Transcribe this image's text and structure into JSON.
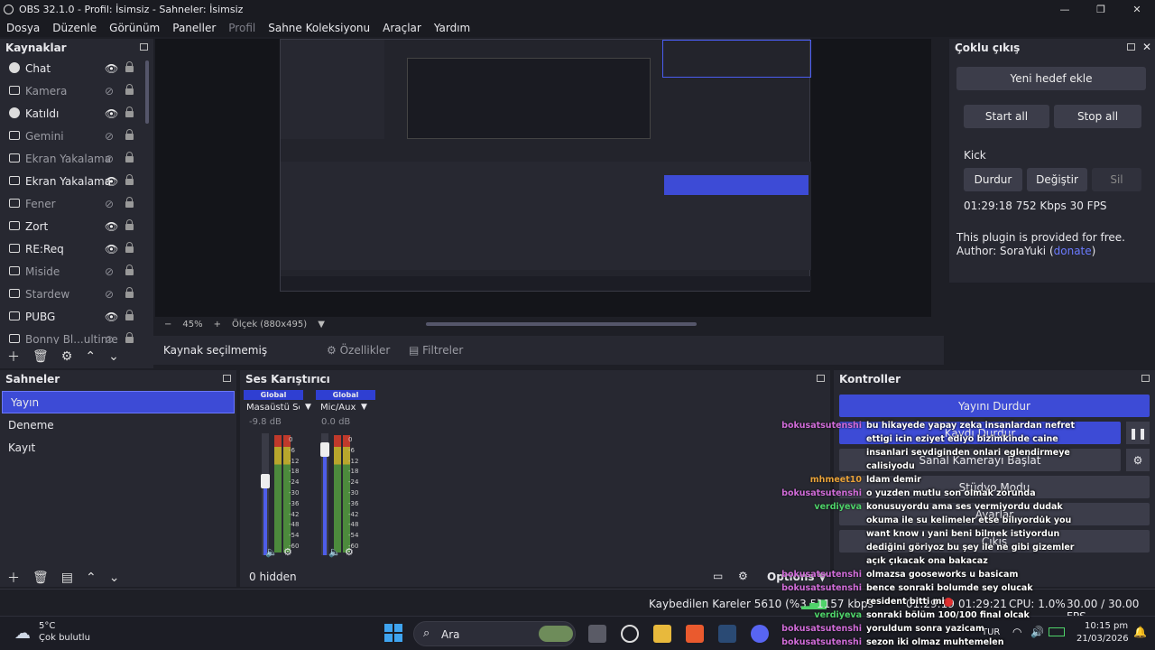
{
  "window": {
    "title": "OBS 32.1.0 - Profil: İsimsiz - Sahneler: İsimsiz"
  },
  "menu": [
    "Dosya",
    "Düzenle",
    "Görünüm",
    "Paneller",
    "Profil",
    "Sahne Koleksiyonu",
    "Araçlar",
    "Yardım"
  ],
  "sources": {
    "title": "Kaynaklar",
    "items": [
      {
        "label": "Chat",
        "visible": true,
        "icon": "globe-icon"
      },
      {
        "label": "Kamera",
        "visible": false,
        "icon": "camera-icon"
      },
      {
        "label": "Katıldı",
        "visible": true,
        "icon": "globe-icon"
      },
      {
        "label": "Gemini",
        "visible": false,
        "icon": "window-icon"
      },
      {
        "label": "Ekran Yakalama",
        "visible": false,
        "icon": "monitor-icon"
      },
      {
        "label": "Ekran Yakalama",
        "visible": true,
        "icon": "monitor-icon"
      },
      {
        "label": "Fener",
        "visible": false,
        "icon": "window-icon"
      },
      {
        "label": "Zort",
        "visible": true,
        "icon": "window-icon"
      },
      {
        "label": "RE:Req",
        "visible": true,
        "icon": "window-icon"
      },
      {
        "label": "Miside",
        "visible": false,
        "icon": "window-icon"
      },
      {
        "label": "Stardew",
        "visible": false,
        "icon": "window-icon"
      },
      {
        "label": "PUBG",
        "visible": true,
        "icon": "window-icon"
      },
      {
        "label": "Bonny Bl...ultime",
        "visible": false,
        "icon": "window-icon"
      }
    ]
  },
  "preview": {
    "zoom": "45%",
    "size_label": "Ölçek (880x495)",
    "no_source": "Kaynak seçilmemiş",
    "properties": "Özellikler",
    "filters": "Filtreler"
  },
  "multi": {
    "title": "Çoklu çıkış",
    "add": "Yeni hedef ekle",
    "start_all": "Start all",
    "stop_all": "Stop all",
    "target": "Kick",
    "stop": "Durdur",
    "edit": "Değiştir",
    "delete": "Sil",
    "stats": "01:29:18  752 Kbps  30 FPS",
    "note1": "This plugin is provided for free.",
    "note2": "Author: SoraYuki (",
    "donate": "donate",
    ")": ")"
  },
  "scenes": {
    "title": "Sahneler",
    "items": [
      "Yayın",
      "Deneme",
      "Kayıt"
    ],
    "selected": 0
  },
  "mixer": {
    "title": "Ses Karıştırıcı",
    "hidden": "0 hidden",
    "channels": [
      {
        "global": "Global",
        "name": "Masaüstü Ses",
        "db": "-9.8 dB",
        "level": 0.62
      },
      {
        "global": "Global",
        "name": "Mic/Aux",
        "db": "0.0 dB",
        "level": 0.92
      }
    ],
    "ticks": [
      "0",
      "-6",
      "-12",
      "-18",
      "-24",
      "-30",
      "-36",
      "-42",
      "-48",
      "-54",
      "-60"
    ]
  },
  "controls": {
    "title": "Kontroller",
    "stream": "Yayını Durdur",
    "record": "Kaydı Durdur",
    "vcam": "Sanal Kamerayı Başlat",
    "studio": "Stüdyo Modu",
    "settings": "Ayarlar",
    "exit": "Çıkış",
    "options": "Options"
  },
  "status": {
    "dropped": "Kaybedilen Kareler 5610 (%3.5)",
    "kbps": "1157 kbps",
    "stream_time": "01:29:19",
    "rec_time": "01:29:21",
    "cpu": "CPU: 1.0%",
    "fps": "30.00 / 30.00 FPS"
  },
  "taskbar": {
    "temp": "5°C",
    "weather": "Çok bulutlu",
    "search": "Ara",
    "lang": "TUR",
    "time": "10:15 pm",
    "date": "21/03/2026"
  },
  "chat": [
    {
      "u": "bokusatsutenshi",
      "m": "bu hikayede yapay zeka insanlardan nefret",
      "c": 0
    },
    {
      "u": "",
      "m": "ettigi icin eziyet ediyo bizimkinde caine",
      "c": 0
    },
    {
      "u": "",
      "m": "insanlari sevdiginden onlari eglendirmeye",
      "c": 0
    },
    {
      "u": "",
      "m": "calisiyodu",
      "c": 0
    },
    {
      "u": "mhmeet10",
      "m": "ldam demir",
      "c": 1
    },
    {
      "u": "bokusatsutenshi",
      "m": "o yuzden mutlu son olmak zorunda",
      "c": 0
    },
    {
      "u": "verdiyeva",
      "m": "konusuyordu ama ses vermiyordu dudak",
      "c": 2
    },
    {
      "u": "",
      "m": "okuma ile su kelimeler etse bilıyordu̇k you",
      "c": 2
    },
    {
      "u": "",
      "m": "want know ı yani beni bilmek istiyordun",
      "c": 2
    },
    {
      "u": "",
      "m": "dediğini göriyoz bu şey ile ne gibi gizemler",
      "c": 2
    },
    {
      "u": "",
      "m": "açık çıkacak ona bakacaz",
      "c": 2
    },
    {
      "u": "bokusatsutenshi",
      "m": "olmazsa gooseworks u basicam",
      "c": 0
    },
    {
      "u": "bokusatsutenshi",
      "m": "bence sonraki bolumde sey olucak",
      "c": 0
    },
    {
      "u": "",
      "m": "resident bitti mi",
      "c": 0
    },
    {
      "u": "verdiyeva",
      "m": "sonraki bölüm 100/100 final olcak",
      "c": 2
    },
    {
      "u": "bokusatsutenshi",
      "m": "yoruldum sonra yazicam",
      "c": 0
    },
    {
      "u": "bokusatsutenshi",
      "m": "sezon iki olmaz muhtemelen",
      "c": 0
    }
  ]
}
